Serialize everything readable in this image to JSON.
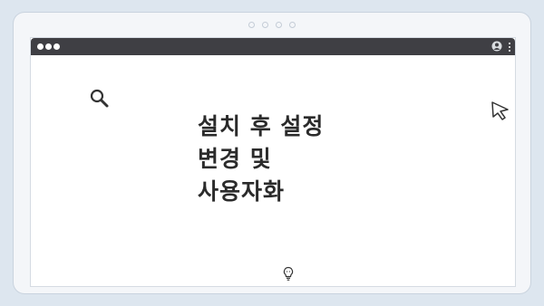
{
  "hero": {
    "title": "설치 후 설정\n변경 및\n사용자화"
  },
  "icons": {
    "window_controls": "window-dots-icon",
    "user": "user-icon",
    "menu": "kebab-menu-icon",
    "search": "search-icon",
    "cursor": "mouse-cursor-icon",
    "idea": "lightbulb-icon"
  },
  "colors": {
    "background": "#dde6ef",
    "titlebar": "#3f3f44",
    "text": "#2b2b2b"
  }
}
